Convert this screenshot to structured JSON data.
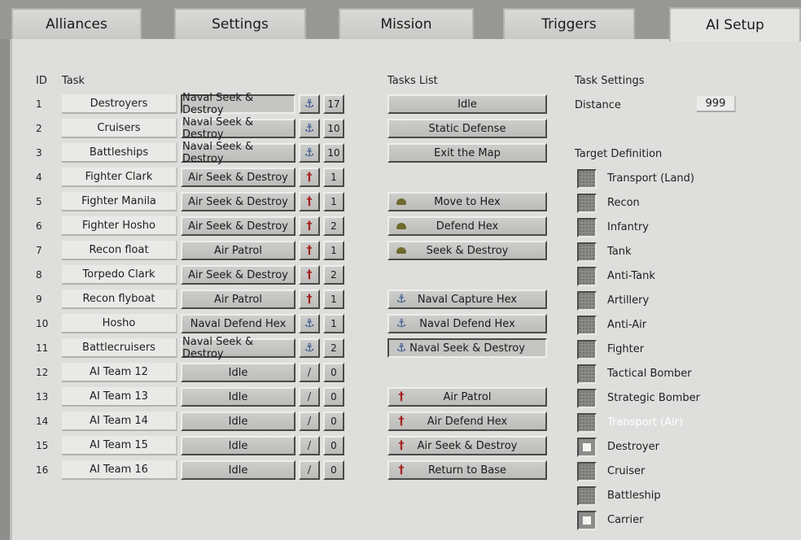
{
  "tabs": [
    "Alliances",
    "Settings",
    "Mission",
    "Triggers",
    "AI Setup"
  ],
  "active_tab": "AI Setup",
  "headers": {
    "id": "ID",
    "task": "Task",
    "tasks_list": "Tasks List",
    "task_settings": "Task Settings",
    "target_definition": "Target Definition"
  },
  "distance": {
    "label": "Distance",
    "value": "999"
  },
  "tasks": [
    {
      "id": "1",
      "name": "Destroyers",
      "action": "Naval Seek & Destroy",
      "icon": "anchor-icon",
      "value": "17",
      "selected": true
    },
    {
      "id": "2",
      "name": "Cruisers",
      "action": "Naval Seek & Destroy",
      "icon": "anchor-icon",
      "value": "10",
      "selected": false
    },
    {
      "id": "3",
      "name": "Battleships",
      "action": "Naval Seek & Destroy",
      "icon": "anchor-icon",
      "value": "10",
      "selected": false
    },
    {
      "id": "4",
      "name": "Fighter Clark",
      "action": "Air Seek & Destroy",
      "icon": "plane-icon",
      "value": "1",
      "selected": false
    },
    {
      "id": "5",
      "name": "Fighter Manila",
      "action": "Air Seek & Destroy",
      "icon": "plane-icon",
      "value": "1",
      "selected": false
    },
    {
      "id": "6",
      "name": "Fighter Hosho",
      "action": "Air Seek & Destroy",
      "icon": "plane-icon",
      "value": "2",
      "selected": false
    },
    {
      "id": "7",
      "name": "Recon float",
      "action": "Air Patrol",
      "icon": "plane-icon",
      "value": "1",
      "selected": false
    },
    {
      "id": "8",
      "name": "Torpedo Clark",
      "action": "Air Seek & Destroy",
      "icon": "plane-icon",
      "value": "2",
      "selected": false
    },
    {
      "id": "9",
      "name": "Recon flyboat",
      "action": "Air Patrol",
      "icon": "plane-icon",
      "value": "1",
      "selected": false
    },
    {
      "id": "10",
      "name": "Hosho",
      "action": "Naval Defend Hex",
      "icon": "anchor-icon",
      "value": "1",
      "selected": false
    },
    {
      "id": "11",
      "name": "Battlecruisers",
      "action": "Naval Seek & Destroy",
      "icon": "anchor-icon",
      "value": "2",
      "selected": false
    },
    {
      "id": "12",
      "name": "AI Team 12",
      "action": "Idle",
      "icon": "slash-icon",
      "value": "0",
      "selected": false
    },
    {
      "id": "13",
      "name": "AI Team 13",
      "action": "Idle",
      "icon": "slash-icon",
      "value": "0",
      "selected": false
    },
    {
      "id": "14",
      "name": "AI Team 14",
      "action": "Idle",
      "icon": "slash-icon",
      "value": "0",
      "selected": false
    },
    {
      "id": "15",
      "name": "AI Team 15",
      "action": "Idle",
      "icon": "slash-icon",
      "value": "0",
      "selected": false
    },
    {
      "id": "16",
      "name": "AI Team 16",
      "action": "Idle",
      "icon": "slash-icon",
      "value": "0",
      "selected": false
    }
  ],
  "tasks_list": [
    {
      "label": "Idle",
      "icon": "",
      "slot": 0,
      "pressed": false
    },
    {
      "label": "Static Defense",
      "icon": "",
      "slot": 1,
      "pressed": false
    },
    {
      "label": "Exit the Map",
      "icon": "",
      "slot": 2,
      "pressed": false
    },
    {
      "label": "Move to Hex",
      "icon": "helmet-icon",
      "slot": 4,
      "pressed": false
    },
    {
      "label": "Defend Hex",
      "icon": "helmet-icon",
      "slot": 5,
      "pressed": false
    },
    {
      "label": "Seek & Destroy",
      "icon": "helmet-icon",
      "slot": 6,
      "pressed": false
    },
    {
      "label": "Naval Capture Hex",
      "icon": "anchor-icon",
      "slot": 8,
      "pressed": false
    },
    {
      "label": "Naval Defend Hex",
      "icon": "anchor-icon",
      "slot": 9,
      "pressed": false
    },
    {
      "label": "Naval Seek & Destroy",
      "icon": "anchor-icon",
      "slot": 10,
      "pressed": true
    },
    {
      "label": "Air Patrol",
      "icon": "plane-icon",
      "slot": 12,
      "pressed": false
    },
    {
      "label": "Air Defend Hex",
      "icon": "plane-icon",
      "slot": 13,
      "pressed": false
    },
    {
      "label": "Air Seek & Destroy",
      "icon": "plane-icon",
      "slot": 14,
      "pressed": false
    },
    {
      "label": "Return to Base",
      "icon": "plane-icon",
      "slot": 15,
      "pressed": false
    }
  ],
  "targets": [
    {
      "label": "Transport (Land)",
      "checked": false,
      "highlight": false
    },
    {
      "label": "Recon",
      "checked": false,
      "highlight": false
    },
    {
      "label": "Infantry",
      "checked": false,
      "highlight": false
    },
    {
      "label": "Tank",
      "checked": false,
      "highlight": false
    },
    {
      "label": "Anti-Tank",
      "checked": false,
      "highlight": false
    },
    {
      "label": "Artillery",
      "checked": false,
      "highlight": false
    },
    {
      "label": "Anti-Air",
      "checked": false,
      "highlight": false
    },
    {
      "label": "Fighter",
      "checked": false,
      "highlight": false
    },
    {
      "label": "Tactical Bomber",
      "checked": false,
      "highlight": false
    },
    {
      "label": "Strategic Bomber",
      "checked": false,
      "highlight": false
    },
    {
      "label": "Transport (Air)",
      "checked": false,
      "highlight": true
    },
    {
      "label": "Destroyer",
      "checked": true,
      "highlight": false
    },
    {
      "label": "Cruiser",
      "checked": false,
      "highlight": false
    },
    {
      "label": "Battleship",
      "checked": false,
      "highlight": false
    },
    {
      "label": "Carrier",
      "checked": true,
      "highlight": false
    }
  ]
}
